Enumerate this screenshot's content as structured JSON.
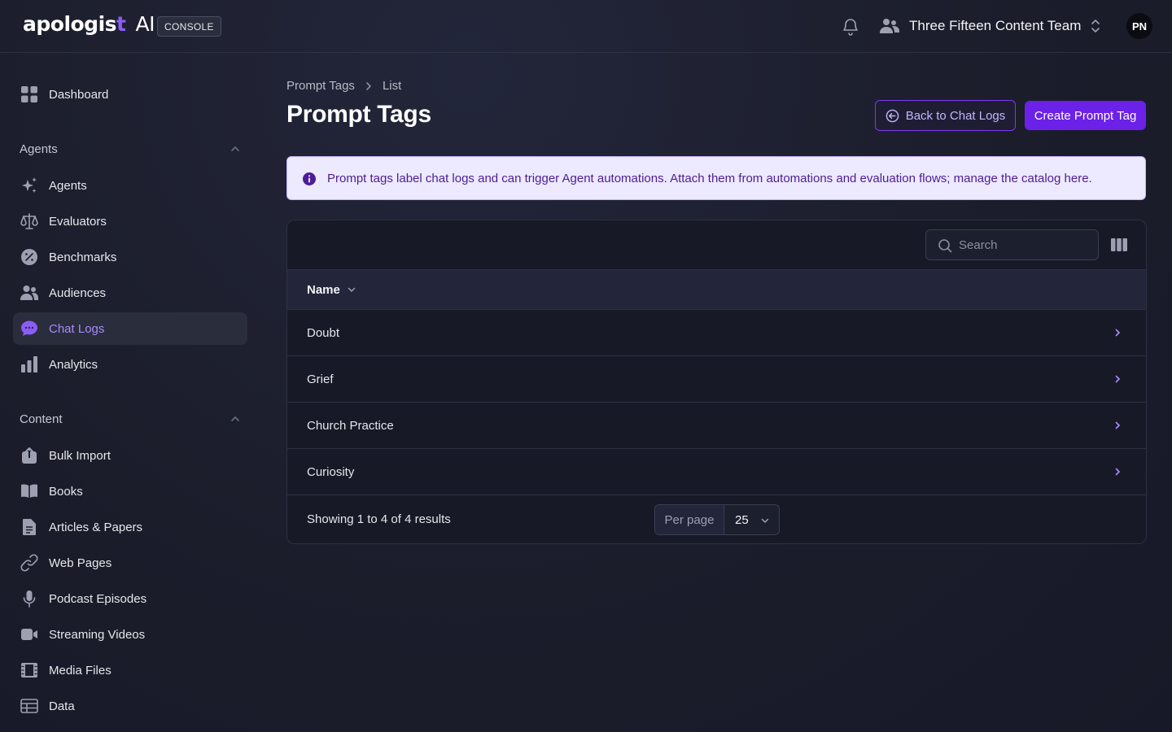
{
  "header": {
    "logo_text": "apologis",
    "logo_cross": "t",
    "logo_ai": "AI",
    "console_badge": "CONSOLE",
    "team_name": "Three Fifteen Content Team",
    "avatar_initials": "PN"
  },
  "sidebar": {
    "dashboard": "Dashboard",
    "agents_group": "Agents",
    "agents_items": [
      "Agents",
      "Evaluators",
      "Benchmarks",
      "Audiences",
      "Chat Logs",
      "Analytics"
    ],
    "content_group": "Content",
    "content_items": [
      "Bulk Import",
      "Books",
      "Articles & Papers",
      "Web Pages",
      "Podcast Episodes",
      "Streaming Videos",
      "Media Files",
      "Data"
    ],
    "active_item": "Chat Logs"
  },
  "breadcrumb": {
    "root": "Prompt Tags",
    "current": "List"
  },
  "page": {
    "title": "Prompt Tags",
    "back_button": "Back to Chat Logs",
    "create_button": "Create Prompt Tag",
    "alert": "Prompt tags label chat logs and can trigger Agent automations. Attach them from automations and evaluation flows; manage the catalog here."
  },
  "table": {
    "search_placeholder": "Search",
    "column_name": "Name",
    "rows": [
      "Doubt",
      "Grief",
      "Church Practice",
      "Curiosity"
    ],
    "summary": "Showing 1 to 4 of 4 results",
    "per_page_label": "Per page",
    "per_page_value": "25"
  },
  "colors": {
    "accent": "#6b21e8",
    "active_text": "#a78bfa",
    "background": "#1b1d2b",
    "alert_bg": "#ede9fe"
  }
}
